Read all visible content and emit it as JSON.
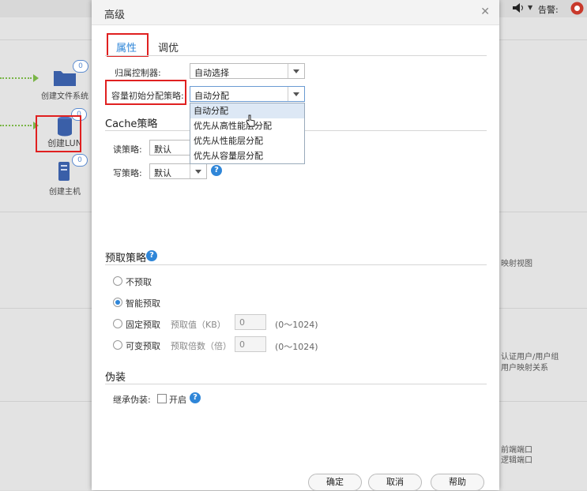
{
  "background": {
    "topbar": {
      "alarm_label": "告警:"
    },
    "items": [
      {
        "label": "创建文件系统",
        "badge": "0"
      },
      {
        "label": "创建LUN",
        "badge": "0"
      },
      {
        "label": "创建主机",
        "badge": "0"
      }
    ],
    "right_texts": [
      "映射视图",
      "认证用户/用户组",
      "用户映射关系",
      "前端端口",
      "逻辑端口"
    ]
  },
  "dialog": {
    "title": "高级",
    "tabs": [
      {
        "label": "属性",
        "active": true
      },
      {
        "label": "调优",
        "active": false
      }
    ],
    "owner_controller": {
      "label": "归属控制器:",
      "value": "自动选择"
    },
    "capacity_policy": {
      "label": "容量初始分配策略:",
      "value": "自动分配",
      "options": [
        "自动分配",
        "优先从高性能层分配",
        "优先从性能层分配",
        "优先从容量层分配"
      ],
      "selected_index": 0
    },
    "cache": {
      "title": "Cache策略",
      "read_label": "读策略:",
      "read_value": "默认",
      "write_label": "写策略:",
      "write_value": "默认"
    },
    "prefetch": {
      "title": "预取策略",
      "options": [
        {
          "label": "不预取",
          "checked": false
        },
        {
          "label": "智能预取",
          "checked": true
        },
        {
          "label": "固定预取",
          "checked": false,
          "field_label": "预取值（KB）",
          "value": "0",
          "range": "(0～1024)"
        },
        {
          "label": "可变预取",
          "checked": false,
          "field_label": "预取倍数（倍）",
          "value": "0",
          "range": "(0～1024)"
        }
      ]
    },
    "disguise": {
      "title": "伪装",
      "label": "继承伪装:",
      "checkbox_label": "开启",
      "checked": false
    },
    "buttons": {
      "ok": "确定",
      "cancel": "取消",
      "help": "帮助"
    }
  }
}
